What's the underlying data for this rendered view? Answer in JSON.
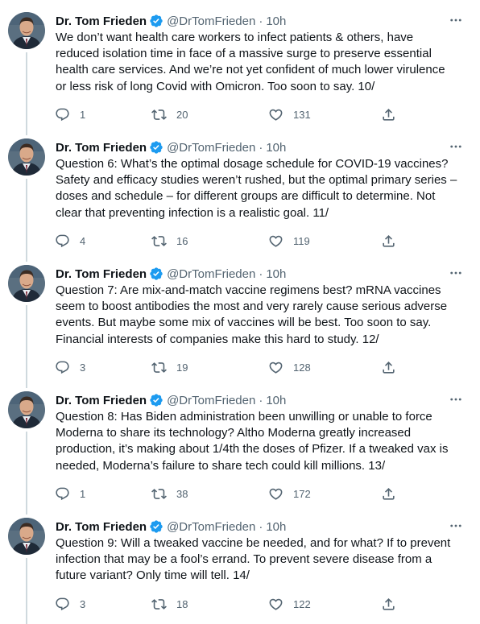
{
  "colors": {
    "verified": "#1d9bf0",
    "secondary_text": "#536471",
    "thread_line": "#cfd9de"
  },
  "tweets": [
    {
      "name": "Dr. Tom Frieden",
      "handle": "@DrTomFrieden",
      "separator": "·",
      "time": "10h",
      "text": "We don’t want health care workers to infect patients & others, have\nreduced isolation time in face of a massive surge to preserve essential\nhealth care services. And we’re not yet confident of much lower virulence\nor less risk of long Covid with Omicron. Too soon to say. 10/",
      "replies": "1",
      "retweets": "20",
      "likes": "131"
    },
    {
      "name": "Dr. Tom Frieden",
      "handle": "@DrTomFrieden",
      "separator": "·",
      "time": "10h",
      "text": "Question 6: What’s the optimal dosage schedule for COVID-19 vaccines?\nSafety and efficacy studies weren’t rushed, but the optimal primary series –\ndoses and schedule – for different groups are difficult to determine. Not\nclear that preventing infection is a realistic goal. 11/",
      "replies": "4",
      "retweets": "16",
      "likes": "119"
    },
    {
      "name": "Dr. Tom Frieden",
      "handle": "@DrTomFrieden",
      "separator": "·",
      "time": "10h",
      "text": "Question 7: Are mix-and-match vaccine regimens best? mRNA vaccines\nseem to boost antibodies the most and very rarely cause serious adverse\nevents. But maybe some mix of vaccines will be best. Too soon to say.\nFinancial interests of companies make this hard to study. 12/",
      "replies": "3",
      "retweets": "19",
      "likes": "128"
    },
    {
      "name": "Dr. Tom Frieden",
      "handle": "@DrTomFrieden",
      "separator": "·",
      "time": "10h",
      "text": "Question 8: Has Biden administration been unwilling or unable to force\nModerna to share its technology? Altho Moderna greatly increased\nproduction, it’s making about 1/4th the doses of Pfizer. If a tweaked vax is\nneeded, Moderna’s failure to share tech could kill millions. 13/",
      "replies": "1",
      "retweets": "38",
      "likes": "172"
    },
    {
      "name": "Dr. Tom Frieden",
      "handle": "@DrTomFrieden",
      "separator": "·",
      "time": "10h",
      "text": "Question 9: Will a tweaked vaccine be needed, and for what? If to prevent\ninfection that may be a fool’s errand. To prevent severe disease from a\nfuture variant? Only time will tell. 14/",
      "replies": "3",
      "retweets": "18",
      "likes": "122"
    }
  ]
}
